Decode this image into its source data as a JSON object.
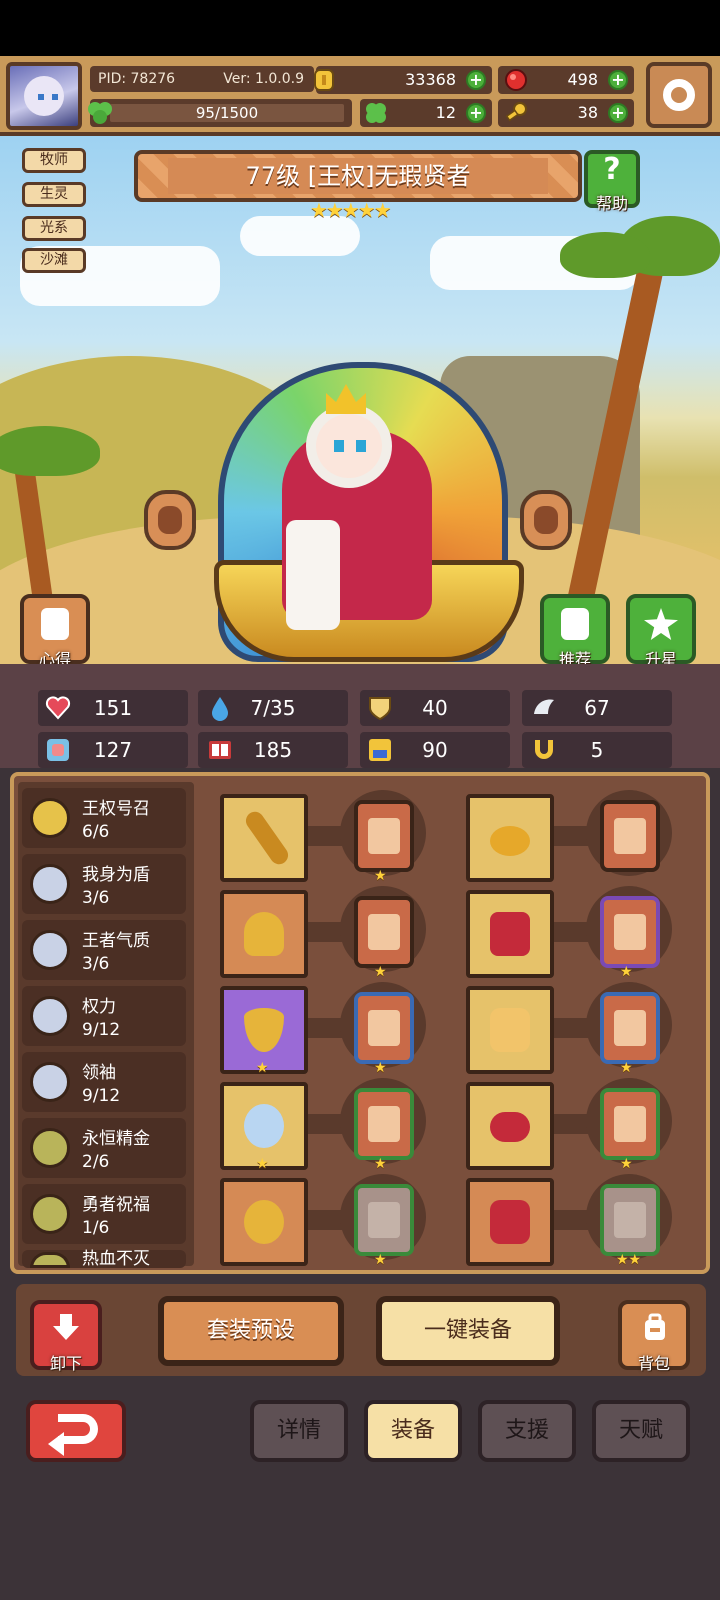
{
  "header": {
    "pid_label": "PID: 78276",
    "version_label": "Ver: 1.0.0.9",
    "exp_text": "95/1500",
    "gold": "33368",
    "gems": "498",
    "clovers": "12",
    "keys": "38"
  },
  "hero": {
    "tags": [
      "牧师",
      "生灵",
      "光系",
      "沙滩"
    ],
    "title": "77级  [王权]无瑕贤者",
    "stars": "★★★★★",
    "help_label": "帮助",
    "insight_label": "心得",
    "recommend_label": "推荐",
    "star_up_label": "升星"
  },
  "stats": {
    "hp": "151",
    "mana": "7/35",
    "defense": "40",
    "speed": "67",
    "strength": "127",
    "magic": "185",
    "resist": "90",
    "luck": "5"
  },
  "sets": [
    {
      "name": "王权号召",
      "count": "6/6"
    },
    {
      "name": "我身为盾",
      "count": "3/6"
    },
    {
      "name": "王者气质",
      "count": "3/6"
    },
    {
      "name": "权力",
      "count": "9/12"
    },
    {
      "name": "领袖",
      "count": "9/12"
    },
    {
      "name": "永恒精金",
      "count": "2/6"
    },
    {
      "name": "勇者祝福",
      "count": "1/6"
    },
    {
      "name": "热血不灭",
      "count": ""
    }
  ],
  "equipment": {
    "slot_stars": [
      "★",
      "★",
      "★",
      "★",
      "★",
      "★",
      "★",
      "★",
      "★",
      "★★"
    ],
    "item_stars": [
      "",
      "",
      "★",
      "",
      "★",
      "★",
      "",
      "★",
      "",
      ""
    ]
  },
  "actions": {
    "unload_label": "卸下",
    "preset_label": "套装预设",
    "equip_all_label": "一键装备",
    "bag_label": "背包"
  },
  "tabs": [
    "详情",
    "装备",
    "支援",
    "天赋"
  ],
  "colors": {
    "accent_green": "#4eb13b",
    "accent_red": "#e0453e",
    "panel_brown": "#7a4f3c",
    "star_gold": "#ffd23a"
  }
}
